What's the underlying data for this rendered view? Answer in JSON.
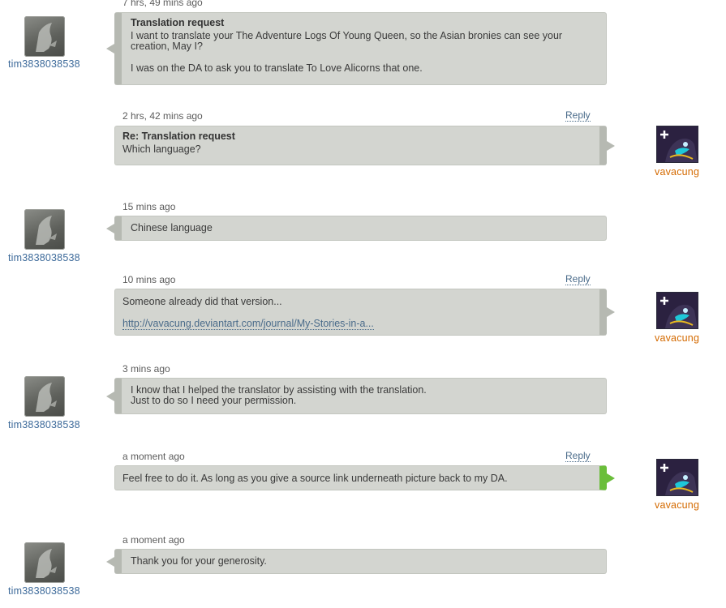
{
  "users": {
    "guest": "tim3838038538",
    "owner": "vavacung"
  },
  "reply_label": "Reply",
  "messages": [
    {
      "time": "7 hrs, 49 mins ago",
      "title": "Translation request",
      "line1": "I want to translate your The Adventure Logs Of Young Queen, so the Asian bronies can see your creation, May I?",
      "line2": "I was on the DA to ask you to translate To Love Alicorns that one."
    },
    {
      "time": "2 hrs, 42 mins ago",
      "title": "Re: Translation request",
      "line1": "Which language?"
    },
    {
      "time": "15 mins ago",
      "line1": "Chinese language"
    },
    {
      "time": "10 mins ago",
      "line1": "Someone already did that version...",
      "link": "http://vavacung.deviantart.com/journal/My-Stories-in-a..."
    },
    {
      "time": "3 mins ago",
      "line1": "I know that I helped the translator by assisting with the translation.",
      "line2": "Just to do so I need your permission."
    },
    {
      "time": "a moment ago",
      "line1": "Feel free to do it. As long as you give a source link underneath picture back to my DA."
    },
    {
      "time": "a moment ago",
      "line1": "Thank you for your generosity."
    }
  ],
  "colors": {
    "bubble": "#d3d5d0",
    "bubble_border": "#b6b9b2",
    "new_message_accent": "#6abe3a",
    "guest_name": "#3d6a9a",
    "owner_name": "#d46a00",
    "link": "#4a6b8a"
  },
  "icons": {
    "guest_avatar": "default-deviant-avatar-icon",
    "owner_avatar": "dark-pony-avatar-icon"
  }
}
